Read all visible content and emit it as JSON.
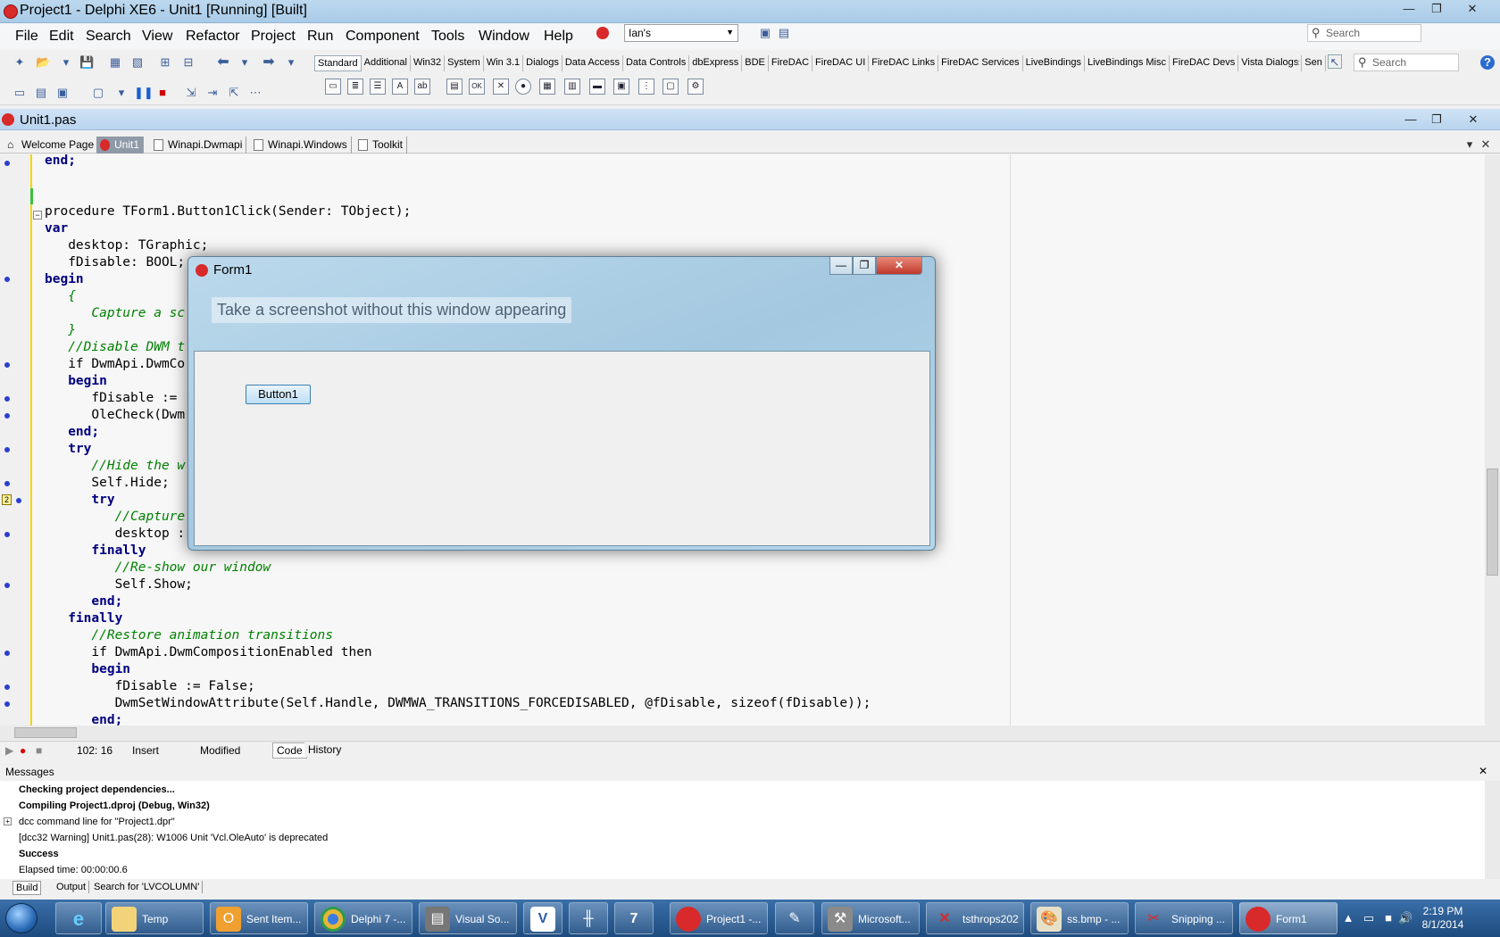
{
  "window": {
    "title": "Project1 - Delphi XE6 - Unit1 [Running] [Built]"
  },
  "menu": [
    "File",
    "Edit",
    "Search",
    "View",
    "Refactor",
    "Project",
    "Run",
    "Component",
    "Tools",
    "Window",
    "Help"
  ],
  "layout_combo": "Ian's",
  "search_top": "Search",
  "search_palette": "Search",
  "palette_tabs": [
    "Standard",
    "Additional",
    "Win32",
    "System",
    "Win 3.1",
    "Dialogs",
    "Data Access",
    "Data Controls",
    "dbExpress",
    "BDE",
    "FireDAC",
    "FireDAC UI",
    "FireDAC Links",
    "FireDAC Services",
    "LiveBindings",
    "LiveBindings Misc",
    "FireDAC Devs",
    "Vista Dialogs",
    "Sen"
  ],
  "editor": {
    "file_title": "Unit1.pas"
  },
  "tabs": [
    "Welcome Page",
    "Unit1",
    "Winapi.Dwmapi",
    "Winapi.Windows",
    "Toolkit"
  ],
  "code": [
    "end;",
    "",
    "",
    "procedure TForm1.Button1Click(Sender: TObject);",
    "var",
    "   desktop: TGraphic;",
    "   fDisable: BOOL;",
    "begin",
    "   {",
    "      Capture a sc",
    "   }",
    "   //Disable DWM t",
    "   if DwmApi.DwmCo",
    "   begin",
    "      fDisable :=",
    "      OleCheck(Dwm                                                                               );",
    "   end;",
    "   try",
    "      //Hide the w",
    "      Self.Hide;",
    "      try",
    "         //Capture",
    "         desktop :",
    "      finally",
    "         //Re-show our window",
    "         Self.Show;",
    "      end;",
    "   finally",
    "      //Restore animation transitions",
    "      if DwmApi.DwmCompositionEnabled then",
    "      begin",
    "         fDisable := False;",
    "         DwmSetWindowAttribute(Self.Handle, DWMWA_TRANSITIONS_FORCEDISABLED, @fDisable, sizeof(fDisable));",
    "      end;"
  ],
  "status": {
    "position": "102: 16",
    "mode": "Insert",
    "modified": "Modified",
    "view_code": "Code",
    "view_history": "History"
  },
  "messages": {
    "title": "Messages",
    "lines": [
      "Checking project dependencies...",
      "Compiling Project1.dproj (Debug, Win32)",
      "dcc command line for \"Project1.dpr\"",
      "[dcc32 Warning] Unit1.pas(28): W1006 Unit 'Vcl.OleAuto' is deprecated",
      "Success",
      "Elapsed time: 00:00:00.6"
    ],
    "tabs": [
      "Build",
      "Output",
      "Search for 'LVCOLUMN'"
    ]
  },
  "form1": {
    "title": "Form1",
    "caption": "Take a screenshot without this window appearing",
    "button": "Button1"
  },
  "taskbar": {
    "items": [
      "Temp",
      "Sent Item...",
      "Delphi 7 -...",
      "Visual So...",
      "Project1 -...",
      "Microsoft...",
      "tsthrops202",
      "ss.bmp - ...",
      "Snipping ...",
      "Form1"
    ],
    "time": "2:19 PM",
    "date": "8/1/2014"
  }
}
